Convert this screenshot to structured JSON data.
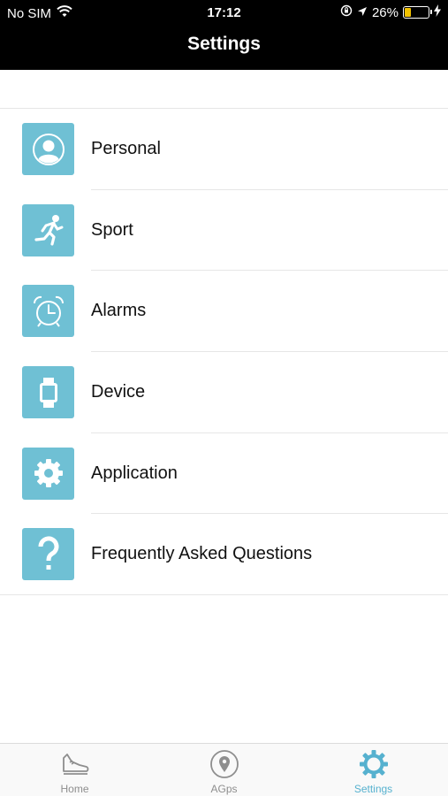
{
  "status_bar": {
    "carrier": "No SIM",
    "time": "17:12",
    "battery_percent": "26%",
    "battery_level": 0.26,
    "icons": [
      "wifi-icon",
      "orientation-lock-icon",
      "location-arrow-icon",
      "battery-icon",
      "charging-bolt-icon"
    ]
  },
  "header": {
    "title": "Settings"
  },
  "settings": {
    "items": [
      {
        "label": "Personal",
        "icon": "person-icon"
      },
      {
        "label": "Sport",
        "icon": "running-icon"
      },
      {
        "label": "Alarms",
        "icon": "alarm-clock-icon"
      },
      {
        "label": "Device",
        "icon": "watch-icon"
      },
      {
        "label": "Application",
        "icon": "gear-icon"
      },
      {
        "label": "Frequently Asked Questions",
        "icon": "question-icon"
      }
    ]
  },
  "tabbar": {
    "tabs": [
      {
        "label": "Home",
        "icon": "shoe-icon",
        "active": false
      },
      {
        "label": "AGps",
        "icon": "location-pin-icon",
        "active": false
      },
      {
        "label": "Settings",
        "icon": "gear-icon",
        "active": true
      }
    ]
  },
  "colors": {
    "accent": "#6fc0d4",
    "active_tab": "#56b1cf",
    "inactive_tab": "#8e8e8e"
  }
}
